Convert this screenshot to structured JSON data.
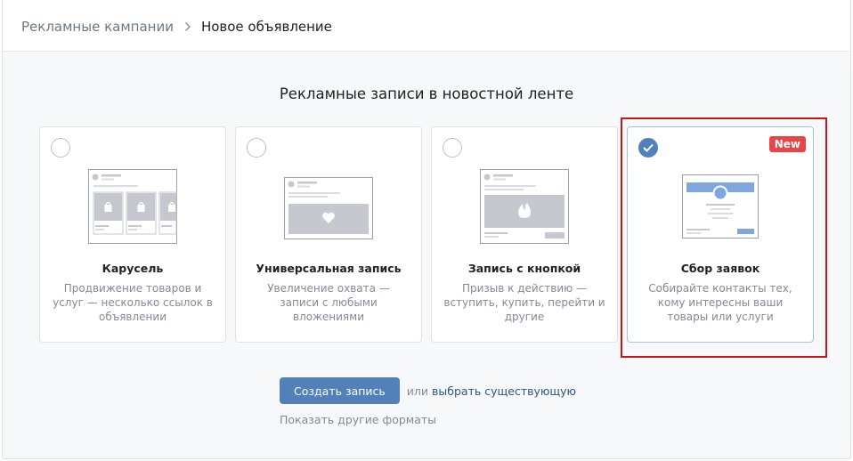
{
  "breadcrumb": {
    "parent": "Рекламные кампании",
    "current": "Новое объявление"
  },
  "section_title": "Рекламные записи в новостной ленте",
  "formats": [
    {
      "title": "Карусель",
      "description": "Продвижение товаров и услуг — несколько ссылок в объявлении",
      "selected": false,
      "illustration": "carousel-illustration"
    },
    {
      "title": "Универсальная запись",
      "description": "Увеличение охвата — записи с любыми вложениями",
      "selected": false,
      "illustration": "universal-post-illustration"
    },
    {
      "title": "Запись с кнопкой",
      "description": "Призыв к действию — вступить, купить, перейти и другие",
      "selected": false,
      "illustration": "button-post-illustration"
    },
    {
      "title": "Сбор заявок",
      "description": "Собирайте контакты тех, кому интересны ваши товары или услуги",
      "selected": true,
      "badge": "New",
      "illustration": "lead-form-illustration"
    }
  ],
  "actions": {
    "create_label": "Создать запись",
    "or_text": "или",
    "choose_existing": "выбрать существующую",
    "other_formats": "Показать другие форматы"
  },
  "colors": {
    "accent": "#5181b8",
    "link": "#2a5885",
    "badge": "#e64646",
    "highlight": "#c4161c"
  }
}
